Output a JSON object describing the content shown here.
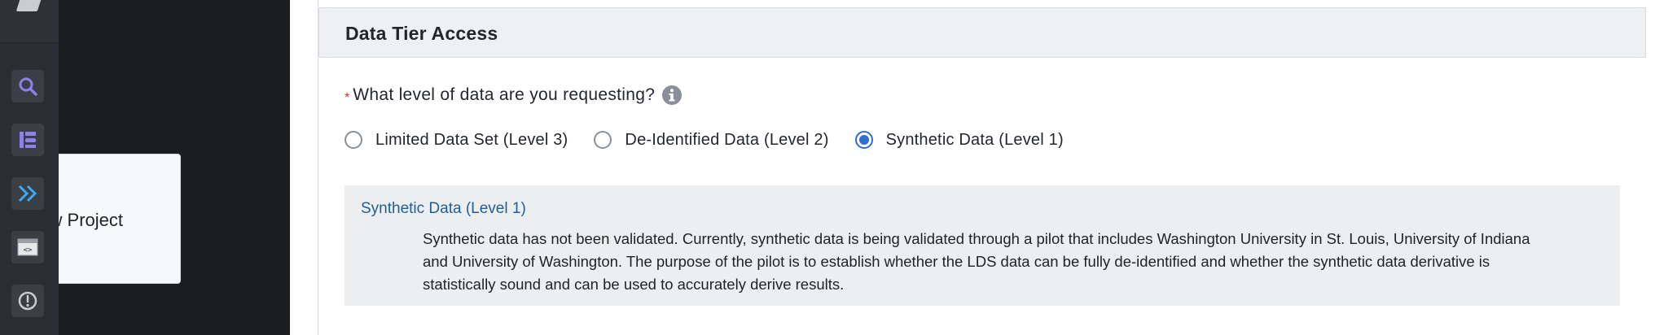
{
  "sidebar": {
    "icons": [
      {
        "name": "search-icon",
        "color": "#8f7fe8"
      },
      {
        "name": "cohort-builder-icon",
        "color": "#8f7fe8"
      },
      {
        "name": "expand-chevrons-icon",
        "color": "#3fa8f0"
      },
      {
        "name": "code-window-icon",
        "color": "#e6e8ea"
      },
      {
        "name": "alert-circle-icon",
        "color": "#c9ccd2"
      }
    ]
  },
  "tooltip": {
    "text": "New Project"
  },
  "section": {
    "title": "Data Tier Access"
  },
  "question": {
    "required_mark": "*",
    "text": "What level of data are you requesting?",
    "info_icon": "info-icon"
  },
  "options": [
    {
      "label": "Limited Data Set (Level 3)",
      "checked": false
    },
    {
      "label": "De-Identified Data (Level 2)",
      "checked": false
    },
    {
      "label": "Synthetic Data (Level 1)",
      "checked": true
    }
  ],
  "description": {
    "title": "Synthetic Data (Level 1)",
    "body": "Synthetic data has not been validated. Currently, synthetic data is being validated through a pilot that includes Washington University in St. Louis, University of Indiana and University of Washington. The purpose of the pilot is to establish whether the LDS data can be fully de-identified and whether the synthetic data derivative is statistically sound and can be used to accurately derive results."
  },
  "colors": {
    "accent": "#2f6fd1",
    "link": "#1f5e99",
    "required": "#d93025"
  }
}
